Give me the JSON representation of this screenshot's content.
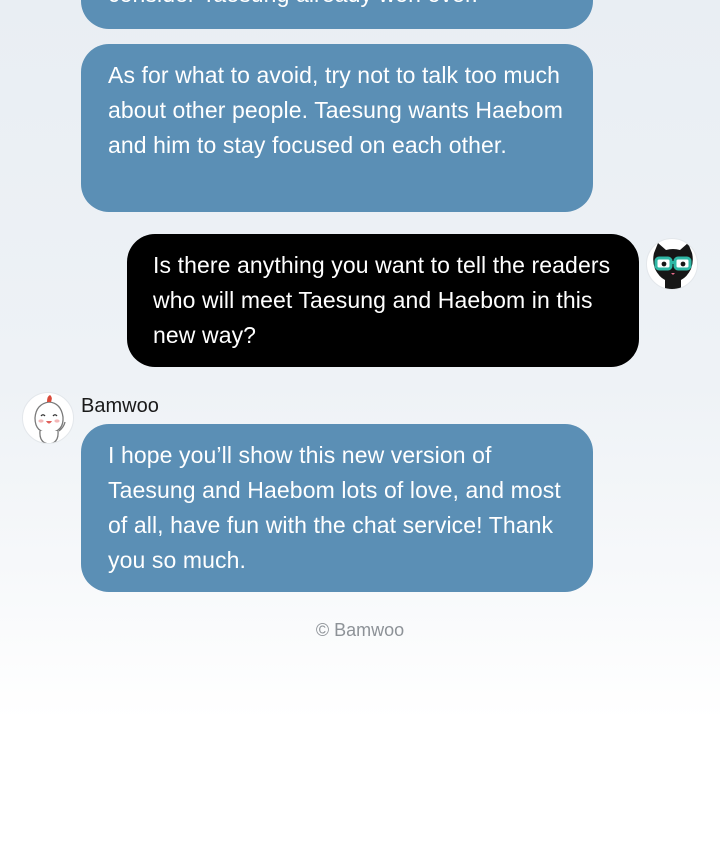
{
  "chat": {
    "messages": [
      {
        "side": "incoming",
        "text": "consider Taesung already won over."
      },
      {
        "side": "incoming",
        "text": "As for what to avoid, try not to talk too much about other people. Taesung wants Haebom and him to stay focused on each other."
      },
      {
        "side": "outgoing",
        "text": "Is there anything you want to tell the readers who will meet Taesung and Haebom in this new way?"
      },
      {
        "side": "incoming",
        "sender": "Bamwoo",
        "text": "I hope you’ll show this new version of Taesung and Haebom lots of love, and most of all, have fun with the chat service! Thank you so much."
      }
    ],
    "interviewer_avatar_icon": "black-cat-glasses-icon",
    "author_avatar_icon": "chestnut-character-icon"
  },
  "footer": {
    "credit": "© Bamwoo"
  },
  "colors": {
    "incoming_bubble": "#5b8fb5",
    "outgoing_bubble": "#000000",
    "bubble_text": "#ffffff",
    "credit_text": "#8d9297"
  }
}
